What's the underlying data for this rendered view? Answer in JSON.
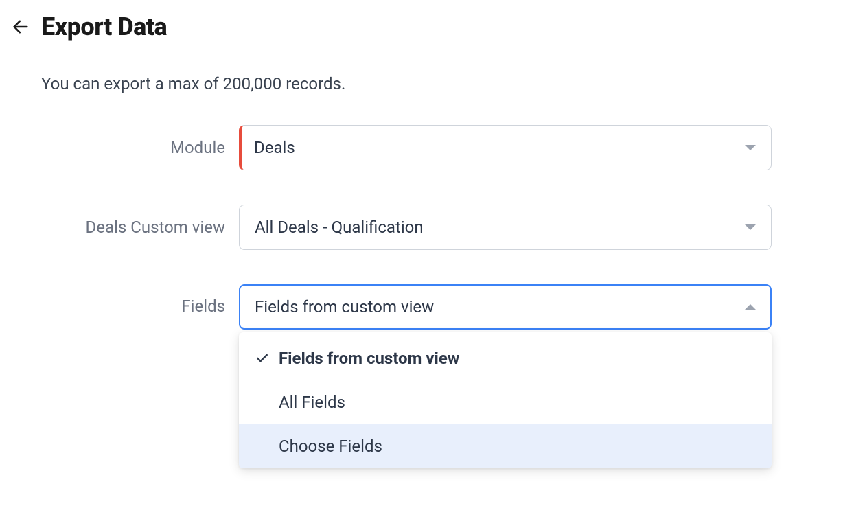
{
  "header": {
    "title": "Export Data",
    "subtitle": "You can export a max of 200,000 records."
  },
  "form": {
    "module": {
      "label": "Module",
      "value": "Deals"
    },
    "customView": {
      "label": "Deals Custom view",
      "value": "All Deals - Qualification"
    },
    "fields": {
      "label": "Fields",
      "value": "Fields from custom view",
      "options": [
        {
          "label": "Fields from custom view",
          "selected": true,
          "hovered": false
        },
        {
          "label": "All Fields",
          "selected": false,
          "hovered": false
        },
        {
          "label": "Choose Fields",
          "selected": false,
          "hovered": true
        }
      ]
    }
  }
}
